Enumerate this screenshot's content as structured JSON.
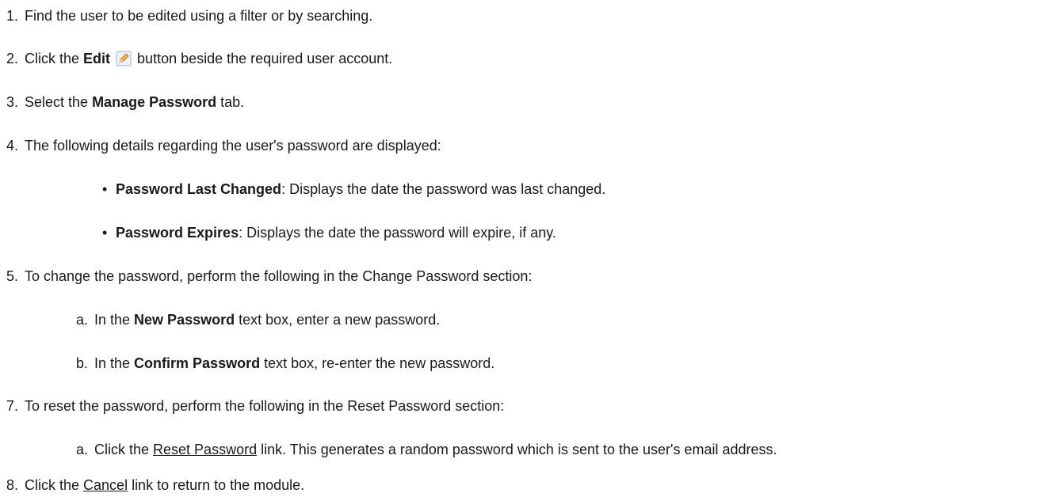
{
  "steps": [
    {
      "num": "1.",
      "text": "Find the user to be edited using a filter or by searching."
    },
    {
      "num": "2.",
      "pre": "Click the ",
      "bold": "Edit",
      "post": " button beside the required user account.",
      "icon": "edit-pencil-icon"
    },
    {
      "num": "3.",
      "pre": "Select the ",
      "bold": "Manage Password",
      "post": " tab."
    },
    {
      "num": "4.",
      "text": "The following details regarding the user's password are displayed:"
    },
    {
      "num": "5.",
      "text": "To change the password, perform the following in the Change Password section:"
    },
    {
      "num": "7.",
      "text": "To reset the password, perform the following in the Reset Password section:"
    },
    {
      "num": "8.",
      "pre": "Click the ",
      "link": "Cancel",
      "post": " link to return to the module."
    }
  ],
  "details": [
    {
      "bullet": "•",
      "bold": "Password Last Changed",
      "post": ": Displays the date the password was last changed."
    },
    {
      "bullet": "•",
      "bold": "Password Expires",
      "post": ": Displays the date the password will expire, if any."
    }
  ],
  "change_substeps": [
    {
      "letter": "a.",
      "pre": "In the ",
      "bold": "New Password",
      "post": " text box, enter a new password."
    },
    {
      "letter": "b.",
      "pre": "In the ",
      "bold": "Confirm Password",
      "post": " text box, re-enter the new password."
    }
  ],
  "reset_substeps": [
    {
      "letter": "a.",
      "pre": "Click the ",
      "link": "Reset Password",
      "post": " link. This generates a random password which is sent to the user's email address."
    }
  ]
}
